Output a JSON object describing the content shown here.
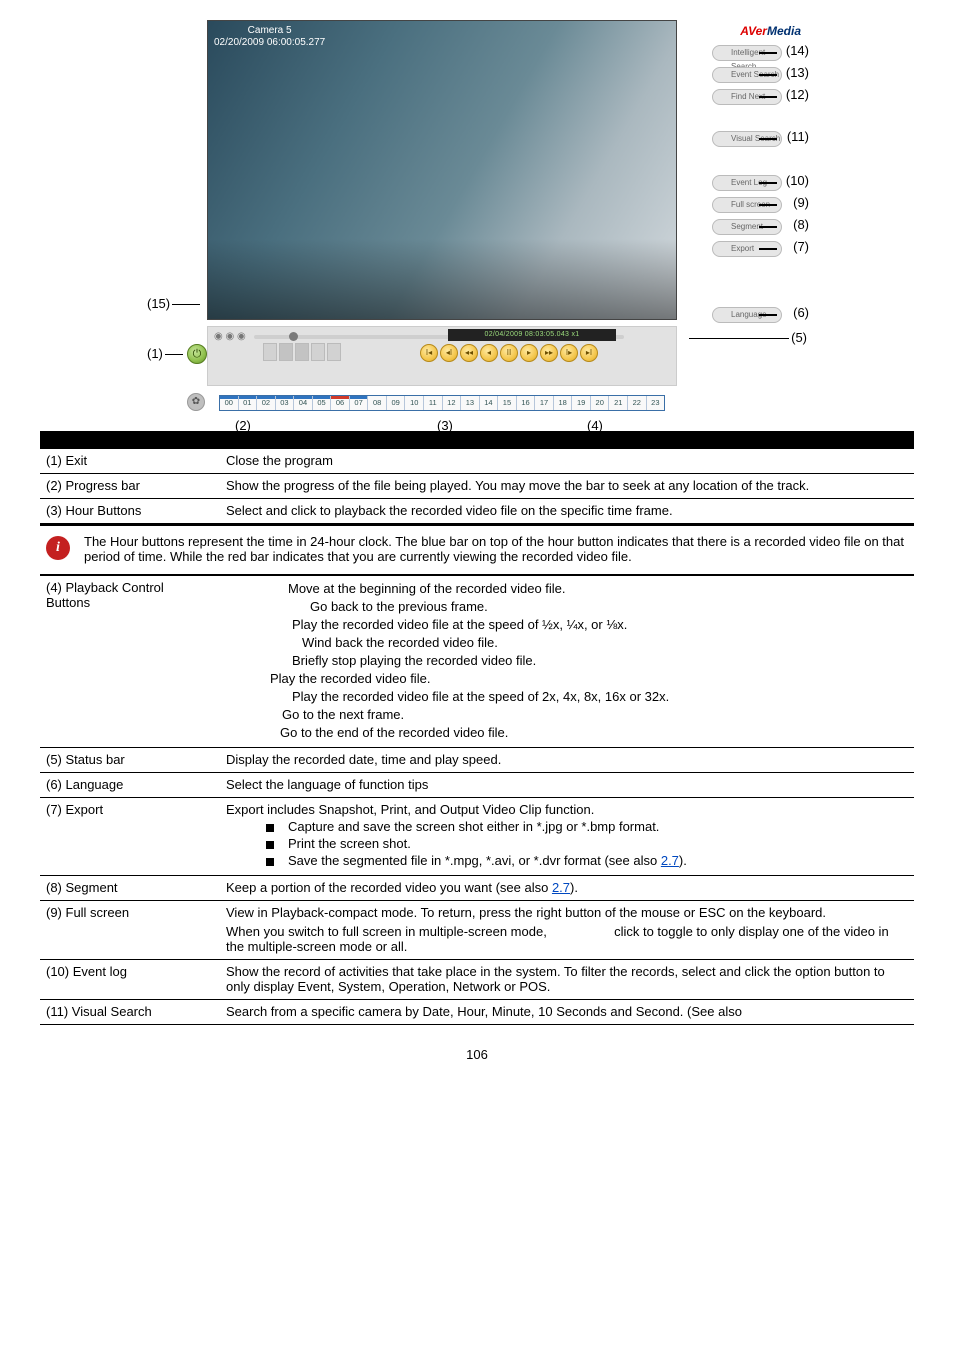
{
  "hero": {
    "camera_label_line1": "Camera 5",
    "camera_label_line2": "02/20/2009 06:00:05.277",
    "brand_a": "AVer",
    "brand_b": "Media",
    "status_text": "02/04/2009 08:03:05.043  x1",
    "badges": {
      "b14": "Intelligent Search",
      "b13": "Event Search",
      "b12": "Find Next",
      "b11": "Visual Search",
      "b10": "Event Log",
      "b9": "Full screen",
      "b8": "Segment",
      "b7": "Export",
      "b6": "Language"
    },
    "callouts": {
      "c14": "(14)",
      "c13": "(13)",
      "c12": "(12)",
      "c11": "(11)",
      "c10": "(10)",
      "c9": "(9)",
      "c8": "(8)",
      "c7": "(7)",
      "c6": "(6)",
      "c5": "(5)",
      "c4": "(4)",
      "c3": "(3)",
      "c2": "(2)",
      "c1": "(1)",
      "c15": "(15)"
    },
    "hours": [
      "00",
      "01",
      "02",
      "03",
      "04",
      "05",
      "06",
      "07",
      "08",
      "09",
      "10",
      "11",
      "12",
      "13",
      "14",
      "15",
      "16",
      "17",
      "18",
      "19",
      "20",
      "21",
      "22",
      "23"
    ]
  },
  "rows": {
    "exit": {
      "k": "(1) Exit",
      "v": "Close the program"
    },
    "progress": {
      "k": "(2) Progress bar",
      "v": "Show the progress of the file being played. You may move the bar to seek at any location of the track."
    },
    "hour": {
      "k": "(3) Hour Buttons",
      "v": "Select and click to playback the recorded video file on the specific time frame."
    },
    "note": "The Hour buttons represent the time in 24-hour clock. The blue bar on top of the hour button indicates that there is a recorded video file on that period of time. While the red bar indicates that you are currently viewing the recorded video file.",
    "playback": {
      "k": "(4) Playback Control Buttons",
      "lines": [
        "Move at the beginning of the recorded video file.",
        "Go back to the previous frame.",
        "Play the recorded video file at the speed of ½x, ¼x, or ⅛x.",
        "Wind back the recorded video file.",
        "Briefly stop playing the recorded video file.",
        "Play the recorded video file.",
        "Play the recorded video file at the speed of 2x, 4x, 8x, 16x or 32x.",
        "Go to the next frame.",
        "Go to the end of the recorded video file."
      ]
    },
    "status": {
      "k": "(5) Status bar",
      "v": "Display the recorded date, time and play speed."
    },
    "language": {
      "k": "(6) Language",
      "v": "Select the language of function tips"
    },
    "export": {
      "k": "(7) Export",
      "lead": "Export includes Snapshot, Print, and Output Video Clip function.",
      "items": [
        "Capture and save the screen shot either in *.jpg or *.bmp format.",
        "Print the screen shot."
      ],
      "last_prefix": "Save the segmented file in *.mpg, *.avi, or *.dvr format (see also ",
      "last_link": "2.7",
      "last_suffix": ")."
    },
    "segment": {
      "k": "(8) Segment",
      "prefix": "Keep a portion of the recorded video you want (see also ",
      "link": "2.7",
      "suffix": ")."
    },
    "fullscreen": {
      "k": "(9) Full screen",
      "p1": "View in Playback-compact mode. To return, press the right button of the mouse or ESC on the keyboard.",
      "p2a": "When you switch to full screen in multiple-screen mode,",
      "p2b": "click to toggle to only display one of the video in the multiple-screen mode or all."
    },
    "eventlog": {
      "k": "(10) Event log",
      "v": "Show the record of activities that take place in the system. To filter the records, select and click the option button to only display Event, System, Operation, Network or POS."
    },
    "visual": {
      "k": "(11) Visual Search",
      "v": "Search from a specific camera by Date, Hour, Minute, 10 Seconds and Second. (See also"
    }
  },
  "page_number": "106"
}
